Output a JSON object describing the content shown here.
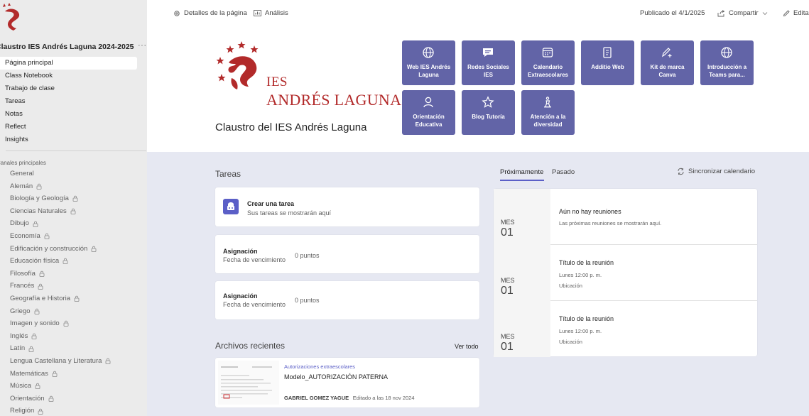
{
  "sidebar": {
    "team_title": "Claustro IES Andrés Laguna 2024-2025",
    "more_label": "···",
    "nav": [
      {
        "label": "Página principal",
        "active": true
      },
      {
        "label": "Class Notebook"
      },
      {
        "label": "Trabajo de clase"
      },
      {
        "label": "Tareas"
      },
      {
        "label": "Notas"
      },
      {
        "label": "Reflect"
      },
      {
        "label": "Insights"
      }
    ],
    "channels_header": "Canales principales",
    "channels": [
      {
        "label": "General",
        "lock": false
      },
      {
        "label": "Alemán",
        "lock": true
      },
      {
        "label": "Biología y Geología",
        "lock": true
      },
      {
        "label": "Ciencias Naturales",
        "lock": true
      },
      {
        "label": "Dibujo",
        "lock": true
      },
      {
        "label": "Economía",
        "lock": true
      },
      {
        "label": "Edificación y construcción",
        "lock": true
      },
      {
        "label": "Educación física",
        "lock": true
      },
      {
        "label": "Filosofía",
        "lock": true
      },
      {
        "label": "Francés",
        "lock": true
      },
      {
        "label": "Geografía e Historia",
        "lock": true
      },
      {
        "label": "Griego",
        "lock": true
      },
      {
        "label": "Imagen y sonido",
        "lock": true
      },
      {
        "label": "Inglés",
        "lock": true
      },
      {
        "label": "Latín",
        "lock": true
      },
      {
        "label": "Lengua Castellana y Literatura",
        "lock": true
      },
      {
        "label": "Matemáticas",
        "lock": true
      },
      {
        "label": "Música",
        "lock": true
      },
      {
        "label": "Orientación",
        "lock": true
      },
      {
        "label": "Religión",
        "lock": true
      }
    ]
  },
  "topbar": {
    "page_details": "Detalles de la página",
    "analytics": "Análisis",
    "published": "Publicado el 4/1/2025",
    "share": "Compartir",
    "edit": "Editar"
  },
  "header": {
    "logo_line1": "IES",
    "logo_line2": "ANDRÉS LAGUNA",
    "page_title": "Claustro del IES Andrés Laguna"
  },
  "quick_links": [
    {
      "label": "Web IES Andrés Laguna",
      "icon": "globe-icon"
    },
    {
      "label": "Redes Sociales IES",
      "icon": "chat-icon"
    },
    {
      "label": "Calendario Extraescolares",
      "icon": "calendar-icon"
    },
    {
      "label": "Additio Web",
      "icon": "document-icon"
    },
    {
      "label": "Kit de marca Canva",
      "icon": "pen-add-icon"
    },
    {
      "label": "Introducción a Teams para...",
      "icon": "globe-icon"
    },
    {
      "label": "Orientación Educativa",
      "icon": "person-icon"
    },
    {
      "label": "Blog Tutoría",
      "icon": "star-icon"
    },
    {
      "label": "Atención a la diversidad",
      "icon": "accessibility-icon"
    }
  ],
  "tasks": {
    "title": "Tareas",
    "create_title": "Crear una tarea",
    "create_sub": "Sus tareas se mostrarán aquí",
    "assignments": [
      {
        "title": "Asignación",
        "due": "Fecha de vencimiento",
        "points": "0 puntos"
      },
      {
        "title": "Asignación",
        "due": "Fecha de vencimiento",
        "points": "0 puntos"
      }
    ]
  },
  "files": {
    "title": "Archivos recientes",
    "view_all": "Ver todo",
    "item": {
      "folder": "Autorizaciones extraescolares",
      "name": "Modelo_AUTORIZACIÓN PATERNA",
      "author": "GABRIEL GOMEZ YAGUE",
      "edited": "Editado a las 18 nov 2024"
    }
  },
  "meetings": {
    "tab_upcoming": "Próximamente",
    "tab_past": "Pasado",
    "sync": "Sincronizar calendario",
    "rows": [
      {
        "month": "MES",
        "day": "01",
        "title": "Aún no hay reuniones",
        "line1": "Las próximas reuniones se mostrarán aquí.",
        "line2": ""
      },
      {
        "month": "MES",
        "day": "01",
        "title": "Título de la reunión",
        "line1": "Lunes 12:00 p. m.",
        "line2": "Ubicación"
      },
      {
        "month": "MES",
        "day": "01",
        "title": "Título de la reunión",
        "line1": "Lunes 12:00 p. m.",
        "line2": "Ubicación"
      }
    ]
  },
  "colors": {
    "accent": "#6264a7",
    "brand_red": "#b22a2a"
  }
}
